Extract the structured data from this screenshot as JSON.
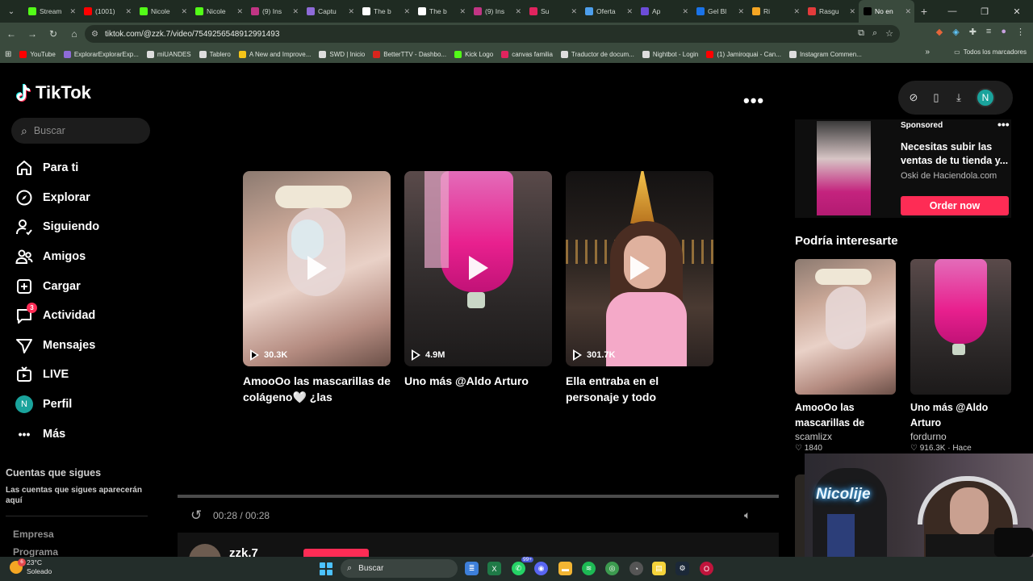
{
  "browser": {
    "tabs": [
      {
        "label": "Stream",
        "color": "#53fc18"
      },
      {
        "label": "(1001)",
        "color": "#ff0000"
      },
      {
        "label": "Nicole",
        "color": "#53fc18"
      },
      {
        "label": "Nicole",
        "color": "#53fc18"
      },
      {
        "label": "(9) Ins",
        "color": "#c13584"
      },
      {
        "label": "Captu",
        "color": "#8e6bd8"
      },
      {
        "label": "The b",
        "color": "#ffffff"
      },
      {
        "label": "The b",
        "color": "#ffffff"
      },
      {
        "label": "(9) Ins",
        "color": "#c13584"
      },
      {
        "label": "Su",
        "color": "#e0245e"
      },
      {
        "label": "Oferta",
        "color": "#4d9fec"
      },
      {
        "label": "Ap",
        "color": "#6c4cd8"
      },
      {
        "label": "Gel Bl",
        "color": "#1a73e8"
      },
      {
        "label": "Ri",
        "color": "#f5a623"
      },
      {
        "label": "Rasgu",
        "color": "#e23b3b"
      },
      {
        "label": "No en",
        "color": "#000000"
      }
    ],
    "url": "tiktok.com/@zzk.7/video/7549256548912991493",
    "bookmarks": [
      {
        "label": "YouTube",
        "color": "#ff0000"
      },
      {
        "label": "ExplorarExplorarExp...",
        "color": "#8e6bd8"
      },
      {
        "label": "miUANDES",
        "color": "#dddddd"
      },
      {
        "label": "Tablero",
        "color": "#dddddd"
      },
      {
        "label": "A New and Improve...",
        "color": "#f5c518"
      },
      {
        "label": "SWD | Inicio",
        "color": "#dddddd"
      },
      {
        "label": "BetterTTV - Dashbo...",
        "color": "#d9251d"
      },
      {
        "label": "Kick Logo",
        "color": "#53fc18"
      },
      {
        "label": "canvas familia",
        "color": "#e0245e"
      },
      {
        "label": "Traductor de docum...",
        "color": "#dddddd"
      },
      {
        "label": "Nightbot - Login",
        "color": "#dddddd"
      },
      {
        "label": "(1) Jamiroquai - Can...",
        "color": "#ff0000"
      },
      {
        "label": "Instagram Commen...",
        "color": "#dddddd"
      }
    ],
    "all_bookmarks": "Todos los marcadores"
  },
  "tiktok": {
    "logo": "TikTok",
    "search_placeholder": "Buscar",
    "nav": [
      {
        "label": "Para ti"
      },
      {
        "label": "Explorar"
      },
      {
        "label": "Siguiendo"
      },
      {
        "label": "Amigos"
      },
      {
        "label": "Cargar"
      },
      {
        "label": "Actividad",
        "badge": "3"
      },
      {
        "label": "Mensajes"
      },
      {
        "label": "LIVE"
      },
      {
        "label": "Perfil"
      },
      {
        "label": "Más"
      }
    ],
    "profile_initial": "N",
    "following_title": "Cuentas que sigues",
    "following_desc": "Las cuentas que sigues aparecerán aquí",
    "footer_links": [
      "Empresa",
      "Programa"
    ],
    "more_label": "•••",
    "grid_videos": [
      {
        "views": "30.3K",
        "caption": "AmooOo las mascarillas de colágeno🤍 ¿las conocías?..."
      },
      {
        "views": "4.9M",
        "caption": "Uno más @Aldo Arturo"
      },
      {
        "views": "301.7K",
        "caption": "Ella entraba en el personaje y todo AMOREEEE 💋 tren..."
      }
    ],
    "player": {
      "time": "00:28 / 00:28",
      "progress": 1.0
    },
    "author": {
      "name": "zzk.7"
    },
    "sponsored": {
      "label": "Sponsored",
      "title": "Necesitas subir las ventas de tu tienda y...",
      "source": "Oski de Haciendola.com",
      "cta": "Order now"
    },
    "interest_title": "Podría interesarte",
    "interest_cards": [
      {
        "title": "AmooOo las mascarillas de",
        "author": "scamlizx",
        "stats": "♡ 1840"
      },
      {
        "title": "Uno más @Aldo Arturo",
        "author": "fordurno",
        "stats": "♡ 916.3K · Hace"
      }
    ]
  },
  "webcam": {
    "neon_text": "Nicolije"
  },
  "taskbar": {
    "temp": "23°C",
    "condition": "Soleado",
    "weather_badge": "6",
    "search_label": "Buscar",
    "whatsapp_badge": "99+"
  }
}
